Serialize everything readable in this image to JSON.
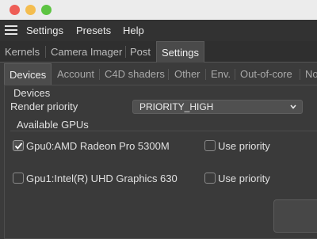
{
  "menubar": {
    "items": [
      "Settings",
      "Presets",
      "Help"
    ]
  },
  "main_tabs": {
    "items": [
      "Kernels",
      "Camera Imager",
      "Post",
      "Settings"
    ],
    "active": "Settings"
  },
  "settings_tabs": {
    "items": [
      "Devices",
      "Account",
      "C4D shaders",
      "Other",
      "Env.",
      "Out-of-core",
      "No"
    ],
    "active": "Devices"
  },
  "devices": {
    "section_title": "Devices",
    "render_priority_label": "Render priority",
    "render_priority_value": "PRIORITY_HIGH",
    "available_gpus_title": "Available GPUs",
    "gpus": [
      {
        "name": "Gpu0:AMD Radeon Pro 5300M",
        "enabled": true,
        "use_priority_label": "Use priority",
        "use_priority": false
      },
      {
        "name": "Gpu1:Intel(R) UHD Graphics 630",
        "enabled": false,
        "use_priority_label": "Use priority",
        "use_priority": false
      }
    ]
  }
}
